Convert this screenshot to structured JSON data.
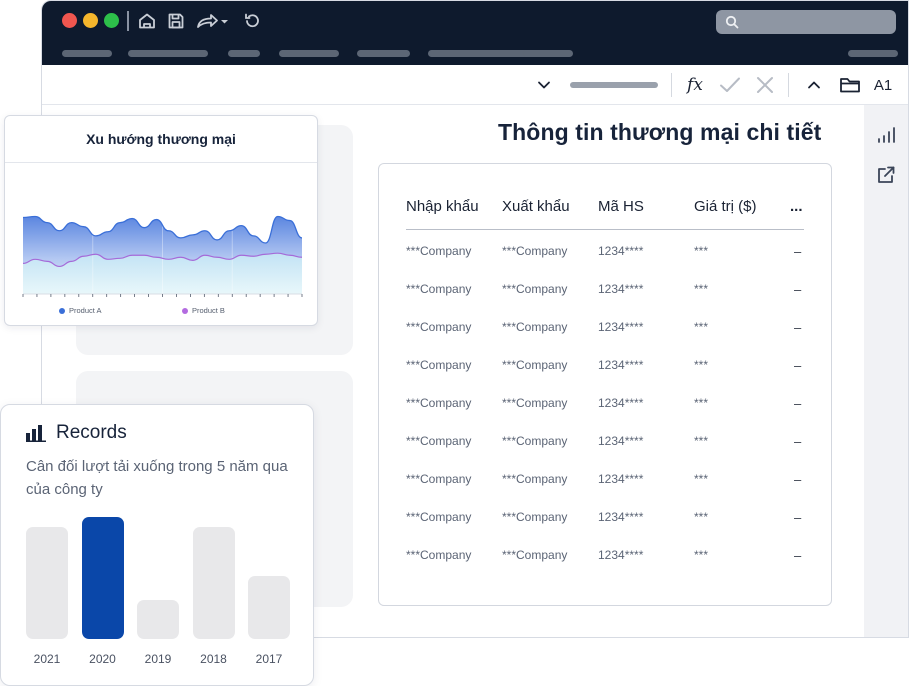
{
  "titlebar": {
    "window_controls": [
      "close",
      "minimize",
      "maximize"
    ],
    "icons": [
      "home-icon",
      "save-icon",
      "share-icon",
      "undo-icon"
    ],
    "search_icon": "search-icon"
  },
  "formula_bar": {
    "fx_label": "fx",
    "cell_ref": "A1"
  },
  "main": {
    "title": "Thông tin thương mại chi tiết",
    "columns": [
      "Nhập khẩu",
      "Xuất khẩu",
      "Mã HS",
      "Giá trị ($)",
      "..."
    ],
    "rows": [
      [
        "***Company",
        "***Company",
        "1234****",
        "***",
        "–"
      ],
      [
        "***Company",
        "***Company",
        "1234****",
        "***",
        "–"
      ],
      [
        "***Company",
        "***Company",
        "1234****",
        "***",
        "–"
      ],
      [
        "***Company",
        "***Company",
        "1234****",
        "***",
        "–"
      ],
      [
        "***Company",
        "***Company",
        "1234****",
        "***",
        "–"
      ],
      [
        "***Company",
        "***Company",
        "1234****",
        "***",
        "–"
      ],
      [
        "***Company",
        "***Company",
        "1234****",
        "***",
        "–"
      ],
      [
        "***Company",
        "***Company",
        "1234****",
        "***",
        "–"
      ],
      [
        "***Company",
        "***Company",
        "1234****",
        "***",
        "–"
      ]
    ]
  },
  "trend_card": {
    "title": "Xu hướng thương mại",
    "legend": [
      {
        "name": "Product A",
        "color": "#3a6fd8"
      },
      {
        "name": "Product B",
        "color": "#b36be0"
      }
    ]
  },
  "records_card": {
    "title": "Records",
    "subtitle": "Cân đối lượt tải xuống trong 5 năm qua của công ty",
    "highlight_color": "#0a47a9",
    "muted_color": "#e8e8ea"
  },
  "chart_data": [
    {
      "type": "area",
      "title": "Xu hướng thương mại",
      "series": [
        {
          "name": "Product A",
          "values": [
            0.75,
            0.76,
            0.7,
            0.62,
            0.7,
            0.66,
            0.57,
            0.61,
            0.7,
            0.74,
            0.65,
            0.73,
            0.62,
            0.55,
            0.58,
            0.62,
            0.53,
            0.62,
            0.67,
            0.57,
            0.5,
            0.76,
            0.72,
            0.55
          ]
        },
        {
          "name": "Product B",
          "values": [
            0.3,
            0.34,
            0.32,
            0.27,
            0.32,
            0.37,
            0.39,
            0.34,
            0.35,
            0.38,
            0.38,
            0.36,
            0.34,
            0.36,
            0.33,
            0.38,
            0.36,
            0.34,
            0.38,
            0.37,
            0.39,
            0.4,
            0.38,
            0.36
          ]
        }
      ],
      "legend": "bottom",
      "grid": true
    },
    {
      "type": "bar",
      "title": "Records",
      "categories": [
        "2021",
        "2020",
        "2019",
        "2018",
        "2017"
      ],
      "values": [
        112,
        122,
        39,
        112,
        63
      ],
      "highlight": "2020"
    }
  ]
}
